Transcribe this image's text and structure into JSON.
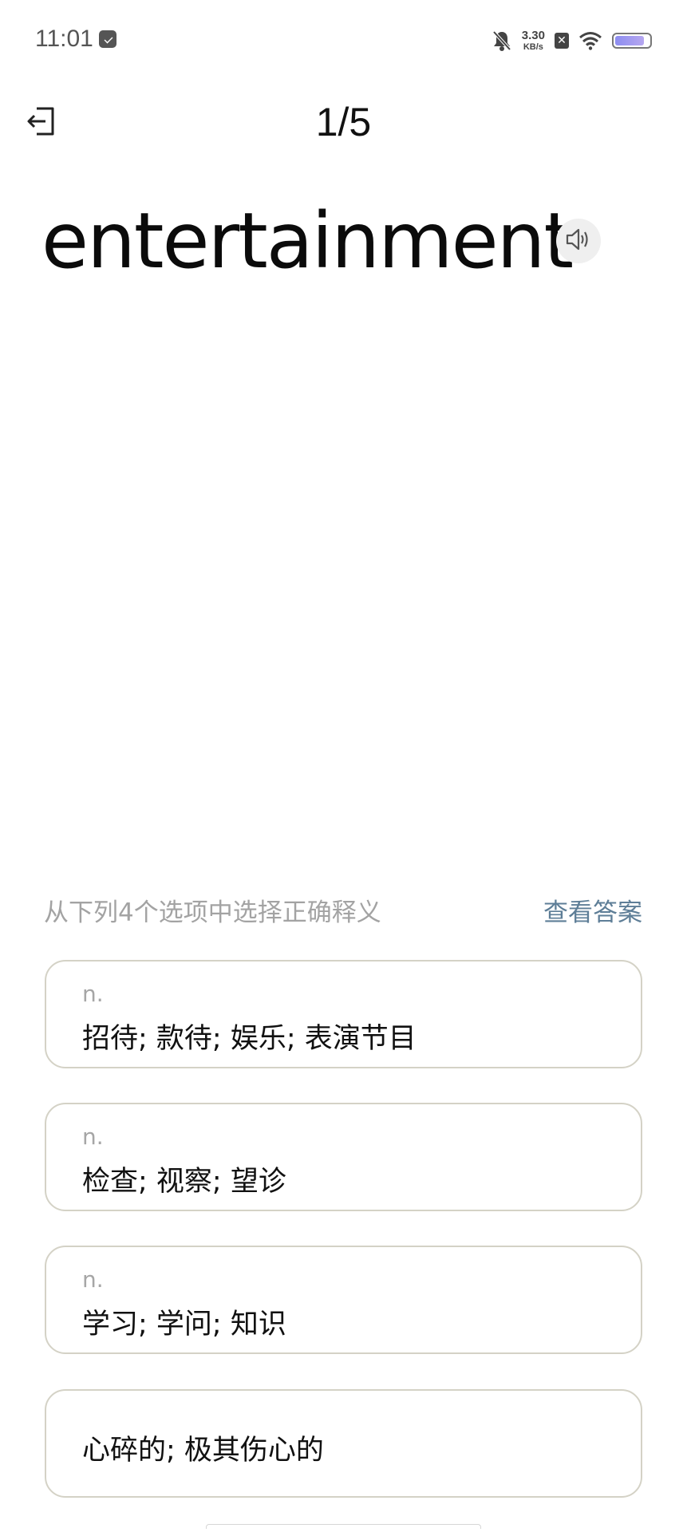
{
  "status_bar": {
    "time": "11:01",
    "net_speed_value": "3.30",
    "net_speed_unit": "KB/s",
    "sim_badge": "✕",
    "battery_level": 0.85
  },
  "header": {
    "progress": "1/5"
  },
  "word": {
    "text": "entertainment"
  },
  "quiz": {
    "instruction": "从下列4个选项中选择正确释义",
    "view_answer_label": "查看答案",
    "options": [
      {
        "pos": "n.",
        "meaning": "招待; 款待; 娱乐; 表演节目"
      },
      {
        "pos": "n.",
        "meaning": "检查; 视察; 望诊"
      },
      {
        "pos": "n.",
        "meaning": "学习; 学问; 知识"
      },
      {
        "pos": "",
        "meaning": "心碎的; 极其伤心的"
      }
    ]
  },
  "colors": {
    "accent_link": "#5e7e97",
    "option_border": "#d4d2c6",
    "muted_text": "#a3a3a3"
  }
}
